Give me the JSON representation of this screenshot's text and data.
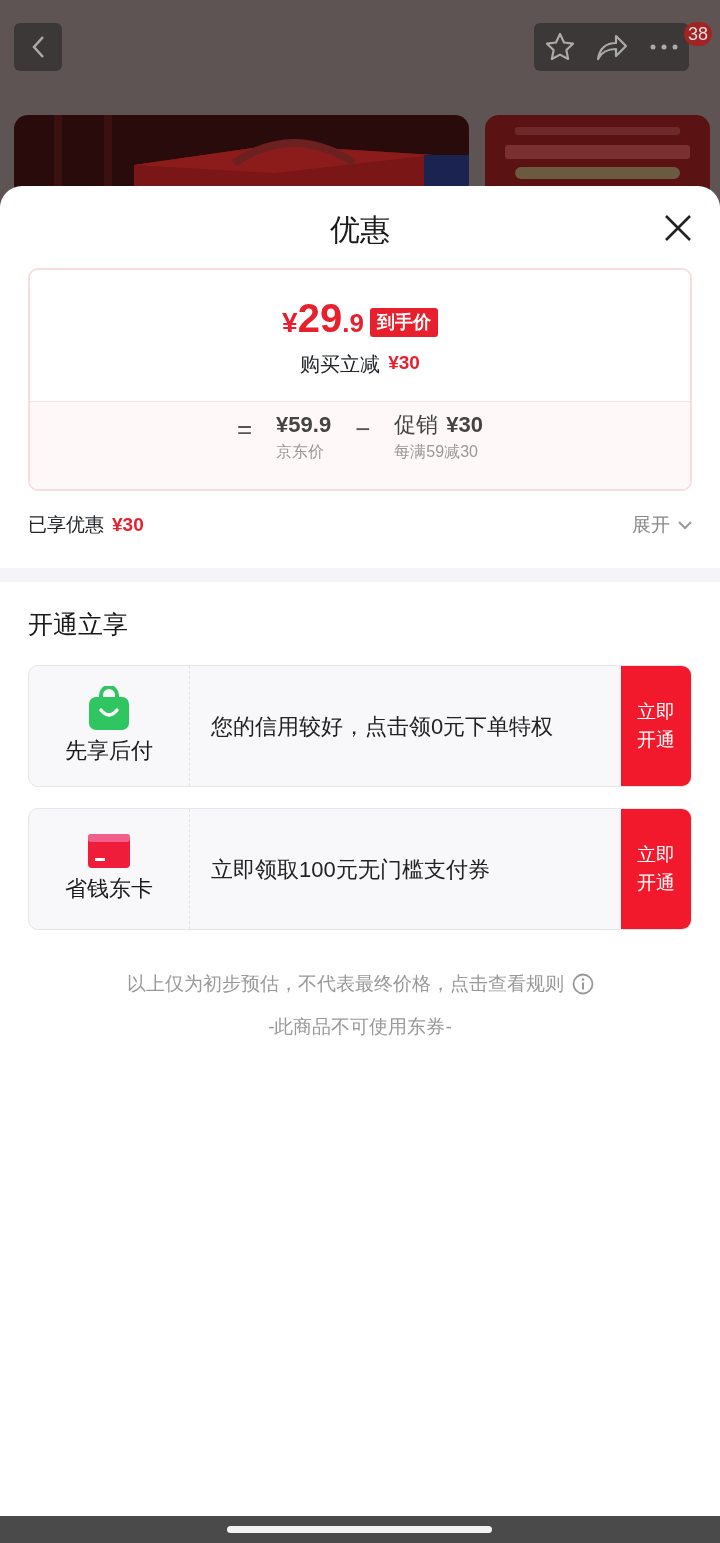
{
  "header": {
    "badge": "38"
  },
  "sheet": {
    "title": "优惠",
    "price": {
      "currency": "¥",
      "integer": "29",
      "decimal": ".9",
      "tag": "到手价",
      "saving_label": "购买立减",
      "saving": "¥30"
    },
    "breakdown": [
      {
        "kind": "operator",
        "text": "="
      },
      {
        "kind": "term",
        "value": "¥59.9",
        "caption": "京东价"
      },
      {
        "kind": "operator",
        "text": "−"
      },
      {
        "kind": "term",
        "label": "促销",
        "value": "¥30",
        "caption": "每满59减30"
      }
    ],
    "enjoyed": {
      "label": "已享优惠",
      "amount": "¥30"
    },
    "expand": "展开",
    "section_title": "开通立享",
    "offers": [
      {
        "kind": "bag",
        "name": "先享后付",
        "text": "您的信用较好，点击领0元下单特权",
        "button": "立即开通"
      },
      {
        "kind": "card",
        "name": "省钱东卡",
        "text": "立即领取100元无门槛支付券",
        "button": "立即开通"
      }
    ],
    "note": "以上仅为初步预估，不代表最终价格，点击查看规则",
    "footer": "-此商品不可使用东券-"
  }
}
